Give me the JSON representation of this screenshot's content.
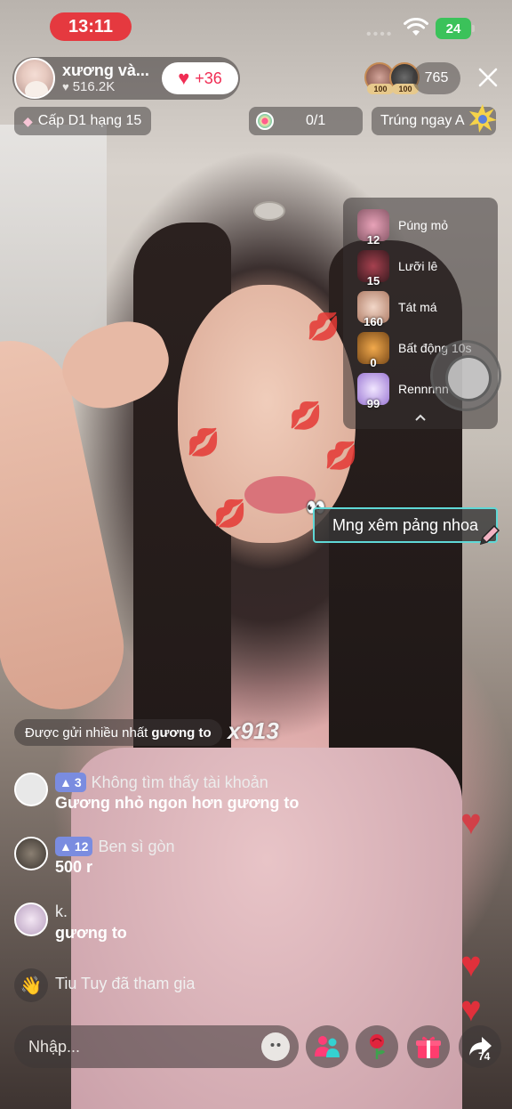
{
  "status_bar": {
    "time": "13:11",
    "battery": "24"
  },
  "host": {
    "name": "xương và...",
    "likes": "516.2K",
    "follow_count": "+36"
  },
  "viewers": {
    "count": "765",
    "badge_1": "100",
    "badge_2": "100"
  },
  "rank": {
    "label": "Cấp D1 hạng 15"
  },
  "goal": {
    "progress": "0/1"
  },
  "promo": {
    "label": "Trúng ngay A"
  },
  "gifts": [
    {
      "name": "Púng mỏ",
      "count": "12"
    },
    {
      "name": "Lưỡi lê",
      "count": "15"
    },
    {
      "name": "Tát má",
      "count": "160"
    },
    {
      "name": "Bất động 10s",
      "count": "0"
    },
    {
      "name": "Rennnnn",
      "count": "99"
    }
  ],
  "sticker_text": "Mng xêm pảng nhoa",
  "top_gift": {
    "prefix": "Được gửi nhiều nhất",
    "gift": "gương to",
    "multiplier": "x913"
  },
  "comments": [
    {
      "level": "3",
      "user": "Không tìm thấy tài khoản",
      "text": "Gương nhỏ ngon hơn gương to"
    },
    {
      "level": "12",
      "user": "Ben sì gòn",
      "text": "500 r"
    },
    {
      "level": "",
      "user": "k.",
      "text": "gương to"
    }
  ],
  "join_message": "Tiu Tuy đã tham gia",
  "input": {
    "placeholder": "Nhập..."
  },
  "share_count": "74",
  "colors": {
    "live_red": "#e5393f",
    "follow_pink": "#f02d54",
    "level_badge": "#7a8ce0",
    "sticker_border": "#5fd8d6"
  }
}
